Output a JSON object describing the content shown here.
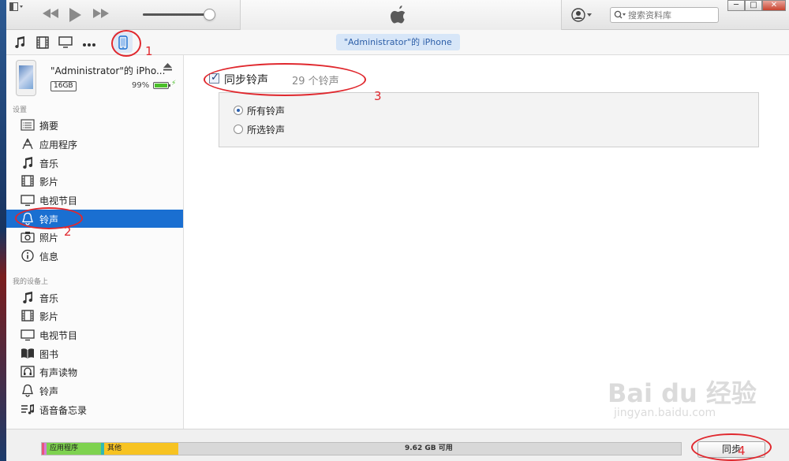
{
  "app": {
    "search_placeholder": "搜索资料库"
  },
  "toolbar": {
    "device_label": "\"Administrator\"的 iPhone"
  },
  "device": {
    "name": "\"Administrator\"的 iPho...",
    "capacity": "16GB",
    "battery": "99%",
    "battery_level": 0.99
  },
  "sidebar": {
    "settings_title": "设置",
    "settings_items": [
      {
        "label": "摘要",
        "icon": "summary-icon"
      },
      {
        "label": "应用程序",
        "icon": "apps-icon"
      },
      {
        "label": "音乐",
        "icon": "music-icon"
      },
      {
        "label": "影片",
        "icon": "film-icon"
      },
      {
        "label": "电视节目",
        "icon": "tv-icon"
      },
      {
        "label": "铃声",
        "icon": "bell-icon",
        "active": true
      },
      {
        "label": "照片",
        "icon": "camera-icon"
      },
      {
        "label": "信息",
        "icon": "info-icon"
      }
    ],
    "ondevice_title": "我的设备上",
    "ondevice_items": [
      {
        "label": "音乐",
        "icon": "music-icon"
      },
      {
        "label": "影片",
        "icon": "film-icon"
      },
      {
        "label": "电视节目",
        "icon": "tv-icon"
      },
      {
        "label": "图书",
        "icon": "book-icon"
      },
      {
        "label": "有声读物",
        "icon": "audiobook-icon"
      },
      {
        "label": "铃声",
        "icon": "bell-icon"
      },
      {
        "label": "语音备忘录",
        "icon": "voice-memo-icon"
      }
    ]
  },
  "main": {
    "sync_label": "同步铃声",
    "sync_count": "29 个铃声",
    "sync_checked": true,
    "options": [
      {
        "label": "所有铃声",
        "selected": true
      },
      {
        "label": "所选铃声",
        "selected": false
      }
    ]
  },
  "bottom": {
    "segments": [
      {
        "label": "应用程序",
        "color": "#7ed24f"
      },
      {
        "label": "其他",
        "color": "#f7c322"
      }
    ],
    "free": "9.62 GB 可用",
    "sync_button": "同步"
  },
  "annotations": [
    "1",
    "2",
    "3",
    "4"
  ],
  "watermark": {
    "logo": "Bai du 经验",
    "url": "jingyan.baidu.com"
  },
  "colors": {
    "accent": "#1a6fd1",
    "annotation": "#e0282e"
  }
}
